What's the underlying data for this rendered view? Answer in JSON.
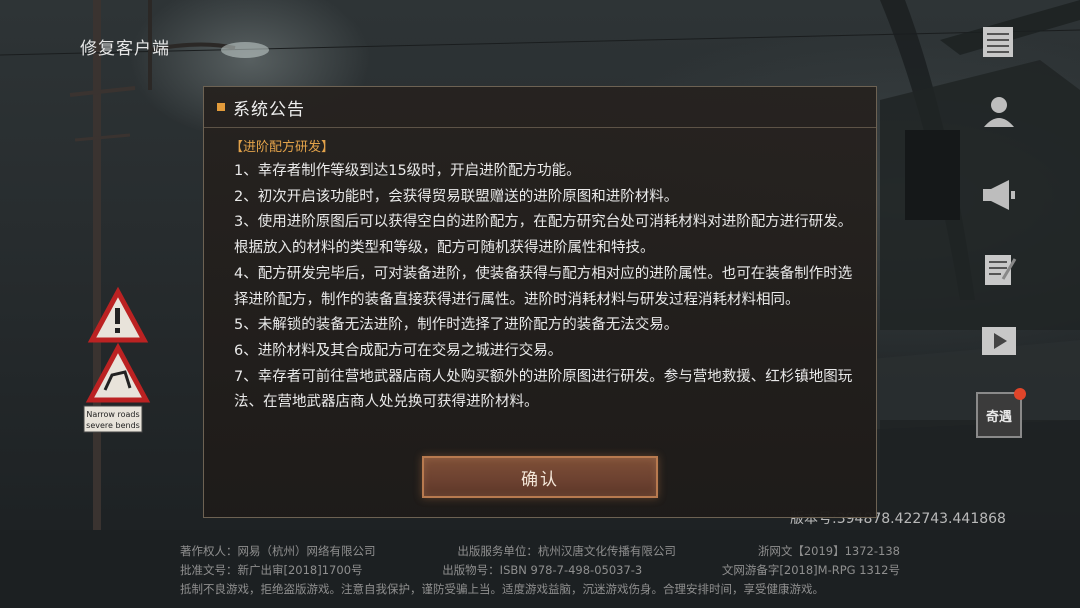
{
  "top_left": {
    "fix_client_label": "修复客户端"
  },
  "side_menu": {
    "items": [
      {
        "icon": "notice-icon"
      },
      {
        "icon": "profile-icon"
      },
      {
        "icon": "megaphone-icon"
      },
      {
        "icon": "notes-icon"
      },
      {
        "icon": "video-play-icon"
      },
      {
        "icon": "qiyu-icon",
        "label": "奇遇",
        "has_notification_dot": true
      }
    ]
  },
  "signs": {
    "road_sign_text": "Narrow roads severe bends"
  },
  "version_text": "版本号:394878.422743.441868",
  "dialog": {
    "title": "系统公告",
    "section_title": "【进阶配方研发】",
    "paragraphs": [
      "1、幸存者制作等级到达15级时，开启进阶配方功能。",
      "2、初次开启该功能时，会获得贸易联盟赠送的进阶原图和进阶材料。",
      "3、使用进阶原图后可以获得空白的进阶配方，在配方研究台处可消耗材料对进阶配方进行研发。根据放入的材料的类型和等级，配方可随机获得进阶属性和特技。",
      "4、配方研发完毕后，可对装备进阶，使装备获得与配方相对应的进阶属性。也可在装备制作时选择进阶配方，制作的装备直接获得进行属性。进阶时消耗材料与研发过程消耗材料相同。",
      "5、未解锁的装备无法进阶，制作时选择了进阶配方的装备无法交易。",
      "6、进阶材料及其合成配方可在交易之城进行交易。",
      "7、幸存者可前往营地武器店商人处购买额外的进阶原图进行研发。参与营地救援、红杉镇地图玩法、在营地武器店商人处兑换可获得进阶材料。"
    ],
    "confirm_label": "确认"
  },
  "footer": {
    "row1": [
      "著作权人：网易（杭州）网络有限公司",
      "出版服务单位：杭州汉唐文化传播有限公司",
      "浙网文【2019】1372-138"
    ],
    "row2": [
      "批准文号：新广出审[2018]1700号",
      "出版物号：ISBN 978-7-498-05037-3",
      "文网游备字[2018]M-RPG 1312号"
    ],
    "row3": "抵制不良游戏，拒绝盗版游戏。注意自我保护，谨防受骗上当。适度游戏益脑，沉迷游戏伤身。合理安排时间，享受健康游戏。"
  },
  "colors": {
    "accent": "#e29b3b",
    "button_border": "#b87a4f",
    "dot": "#e0452a"
  }
}
